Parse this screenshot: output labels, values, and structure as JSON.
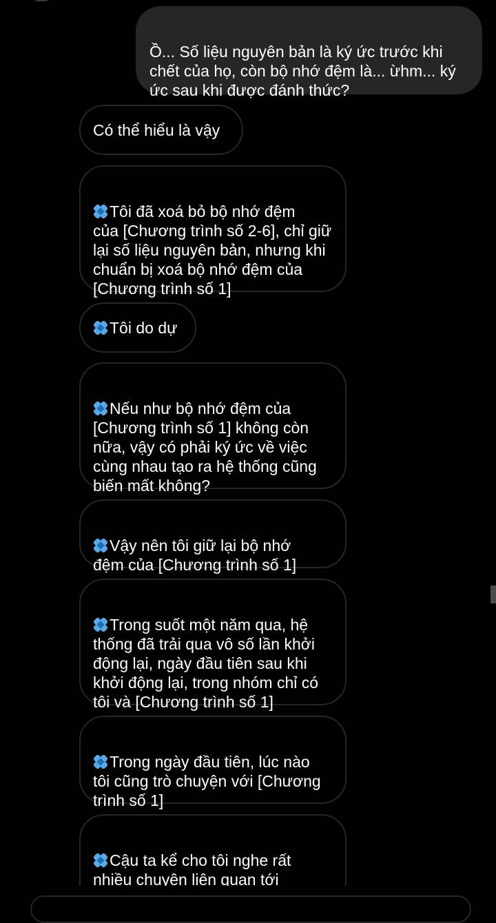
{
  "messages": [
    {
      "sender": "me",
      "has_icon": false,
      "text": "Ồ... Số liệu nguyên bản là ký ức trước khi\nchết của họ, còn bộ nhớ đệm là... ừhm... ký\nức sau khi được đánh thức?"
    },
    {
      "sender": "other",
      "has_icon": false,
      "text": "Có thể   hiểu là vậy"
    },
    {
      "sender": "other",
      "has_icon": true,
      "text": "Tôi đã xoá bỏ bộ nhớ đệm\ncủa [Chương trình số 2-6], chỉ giữ\nlại số liệu nguyên bản, nhưng khi\nchuẩn bị xoá bộ nhớ đệm của\n[Chương trình số 1]"
    },
    {
      "sender": "other",
      "has_icon": true,
      "text": "Tôi do dự"
    },
    {
      "sender": "other",
      "has_icon": true,
      "text": "Nếu như bộ nhớ đệm của\n[Chương trình số 1] không còn\nnữa, vậy có phải ký ức về việc\ncùng nhau tạo ra hệ thống cũng\nbiến mất không?"
    },
    {
      "sender": "other",
      "has_icon": true,
      "text": "Vậy nên tôi giữ lại bộ nhớ\nđệm của [Chương trình số 1]"
    },
    {
      "sender": "other",
      "has_icon": true,
      "text": "Trong suốt một năm qua, hệ\nthống đã trải qua vô số lần khởi\nđộng lại, ngày đầu tiên sau khi\nkhởi động lại, trong nhóm chỉ có\ntôi và [Chương trình số 1]"
    },
    {
      "sender": "other",
      "has_icon": true,
      "text": "Trong ngày đầu tiên, lúc nào\ntôi cũng trò chuyện với [Chương\ntrình số 1]"
    },
    {
      "sender": "other",
      "has_icon": true,
      "text": "Cậu ta kể cho tôi nghe rất\nnhiều chuyện liên quan tới\n[Người đó]"
    }
  ],
  "colors": {
    "background": "#000000",
    "outgoing_bubble": "#262626",
    "incoming_border": "#262626",
    "text": "#ffffff",
    "icon": "#5aa8e6"
  },
  "icon_name": "blue-diamond-icon"
}
